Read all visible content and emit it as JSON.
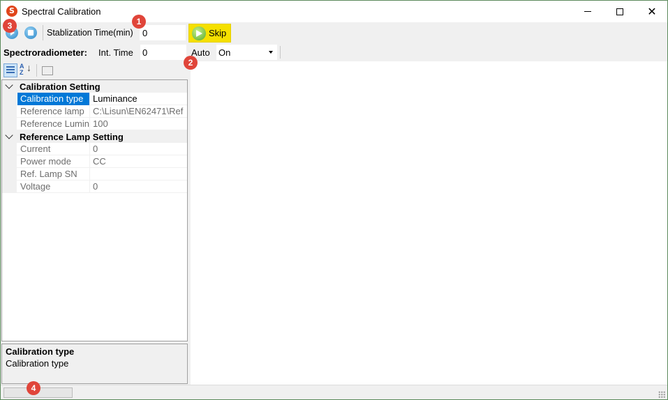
{
  "window": {
    "title": "Spectral Calibration",
    "app_icon_letter": "S",
    "minimize_icon": "minimize-icon",
    "maximize_icon": "maximize-icon",
    "close_glyph": "✕"
  },
  "toolbar": {
    "start_icon": "play-icon",
    "stop_icon": "stop-icon",
    "stabilization_label": "Stablization Time(min)",
    "stabilization_value": "0",
    "skip_label": "Skip"
  },
  "spectro_bar": {
    "title": "Spectroradiometer:",
    "int_time_label": "Int. Time",
    "int_time_value": "0",
    "auto_label": "Auto",
    "auto_value": "On"
  },
  "property_grid": {
    "toolbar_icons": [
      "categorized-icon",
      "alphabetical-sort-icon",
      "property-pages-icon"
    ],
    "categories": [
      {
        "title": "Calibration Setting",
        "properties": [
          {
            "name": "Calibration type",
            "value": "Luminance"
          },
          {
            "name": "Reference lamp",
            "value": "C:\\Lisun\\EN62471\\Ref"
          },
          {
            "name": "Reference Luminance",
            "value": "100"
          }
        ]
      },
      {
        "title": "Reference Lamp Setting",
        "properties": [
          {
            "name": "Current",
            "value": "0"
          },
          {
            "name": "Power mode",
            "value": "CC"
          },
          {
            "name": "Ref. Lamp SN",
            "value": ""
          },
          {
            "name": "Voltage",
            "value": "0"
          }
        ]
      }
    ],
    "selected_property": "Calibration type"
  },
  "description": {
    "title": "Calibration type",
    "text": "Calibration type"
  },
  "markers": [
    "1",
    "2",
    "3",
    "4"
  ],
  "colors": {
    "selection": "#0078d7",
    "skip_button": "#f5e000",
    "marker": "#e0453a"
  }
}
